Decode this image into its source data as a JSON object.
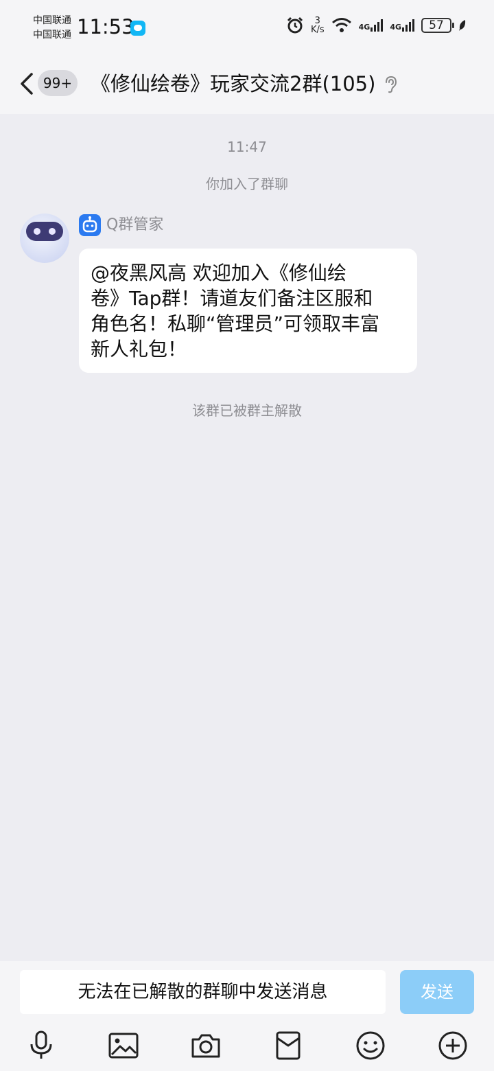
{
  "status_bar": {
    "carrier_1": "中国联通",
    "carrier_2": "中国联通",
    "time": "11:53",
    "net_speed_value": "3",
    "net_speed_unit": "K/s",
    "signal_1_label": "4G",
    "signal_2_label": "4G",
    "battery": "57"
  },
  "header": {
    "unread_count": "99+",
    "title": "《修仙绘卷》玩家交流2群(105)"
  },
  "chat": {
    "time_label": "11:47",
    "system_join": "你加入了群聊",
    "sender_name": "Q群管家",
    "message_line_1": "@夜黑风高 欢迎加入《修仙绘",
    "message_line_2": "卷》Tap群！请道友们备注区服和",
    "message_line_3": "角色名！私聊“管理员”可领取丰富",
    "message_line_4": "新人礼包！",
    "system_disband": "该群已被群主解散"
  },
  "input": {
    "disabled_text": "无法在已解散的群聊中发送消息",
    "send_label": "发送"
  },
  "toolbar": {
    "icons": [
      "microphone-icon",
      "image-icon",
      "camera-icon",
      "red-packet-icon",
      "emoji-icon",
      "plus-icon"
    ]
  },
  "colors": {
    "background": "#ededf2",
    "send_button": "#8ccdf8",
    "bot_tag": "#2b7af0",
    "system_text": "#8e8e93"
  }
}
